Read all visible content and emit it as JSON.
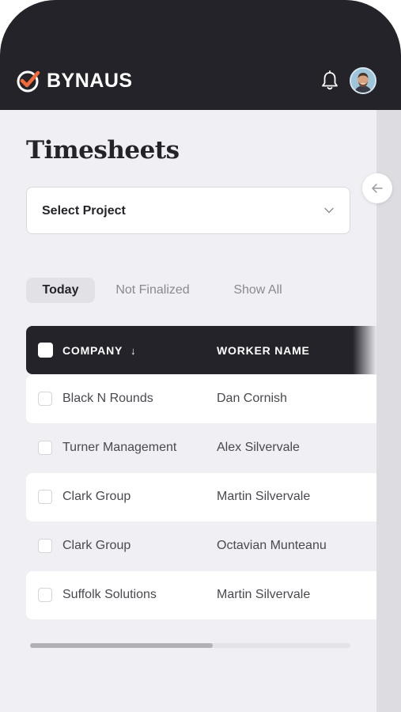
{
  "app": {
    "brand": "BYNAUS",
    "accent": "#f26a3a"
  },
  "header": {
    "bell_icon": "bell-icon",
    "avatar": "user-avatar"
  },
  "page": {
    "title": "Timesheets"
  },
  "project_select": {
    "label": "Select Project"
  },
  "filters": [
    {
      "label": "Today",
      "active": true
    },
    {
      "label": "Not Finalized",
      "active": false
    },
    {
      "label": "Show All",
      "active": false
    }
  ],
  "table": {
    "columns": [
      "COMPANY",
      "WORKER NAME"
    ],
    "sort_indicator": "↓",
    "rows": [
      {
        "company": "Black N Rounds",
        "worker": "Dan Cornish"
      },
      {
        "company": "Turner Management",
        "worker": "Alex Silvervale"
      },
      {
        "company": "Clark Group",
        "worker": "Martin Silvervale"
      },
      {
        "company": "Clark Group",
        "worker": "Octavian Munteanu"
      },
      {
        "company": "Suffolk Solutions",
        "worker": "Martin Silvervale"
      }
    ]
  },
  "scrollbar": {
    "position_fraction": 0.57
  }
}
